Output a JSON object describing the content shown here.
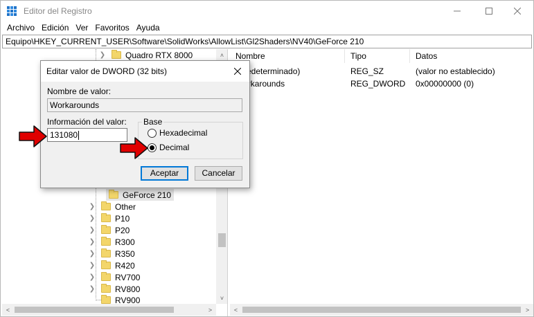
{
  "window": {
    "title": "Editor del Registro",
    "address_path": "Equipo\\HKEY_CURRENT_USER\\Software\\SolidWorks\\AllowList\\Gl2Shaders\\NV40\\GeForce 210"
  },
  "menu": {
    "items": [
      "Archivo",
      "Edición",
      "Ver",
      "Favoritos",
      "Ayuda"
    ]
  },
  "tree": {
    "items": [
      {
        "label": "Quadro RTX 8000"
      },
      {
        "label": "GeForce 210"
      },
      {
        "label": "Other"
      },
      {
        "label": "P10"
      },
      {
        "label": "P20"
      },
      {
        "label": "R300"
      },
      {
        "label": "R350"
      },
      {
        "label": "R420"
      },
      {
        "label": "RV700"
      },
      {
        "label": "RV800"
      },
      {
        "label": "RV900"
      }
    ]
  },
  "values_list": {
    "columns": [
      "Nombre",
      "Tipo",
      "Datos"
    ],
    "rows": [
      {
        "name": "(Predeterminado)",
        "type": "REG_SZ",
        "data": "(valor no establecido)"
      },
      {
        "name": "Workarounds",
        "type": "REG_DWORD",
        "data": "0x00000000 (0)"
      }
    ]
  },
  "dialog": {
    "title": "Editar valor de DWORD (32 bits)",
    "value_name_label": "Nombre de valor:",
    "value_name": "Workarounds",
    "value_data_label": "Información del valor:",
    "value_data": "131080",
    "base_label": "Base",
    "base_options": [
      {
        "label": "Hexadecimal",
        "checked": false
      },
      {
        "label": "Decimal",
        "checked": true
      }
    ],
    "ok_label": "Aceptar",
    "cancel_label": "Cancelar"
  },
  "colors": {
    "annotation_arrow": "#e00000",
    "default_button_border": "#0078d7",
    "folder": "#f3d66b"
  }
}
